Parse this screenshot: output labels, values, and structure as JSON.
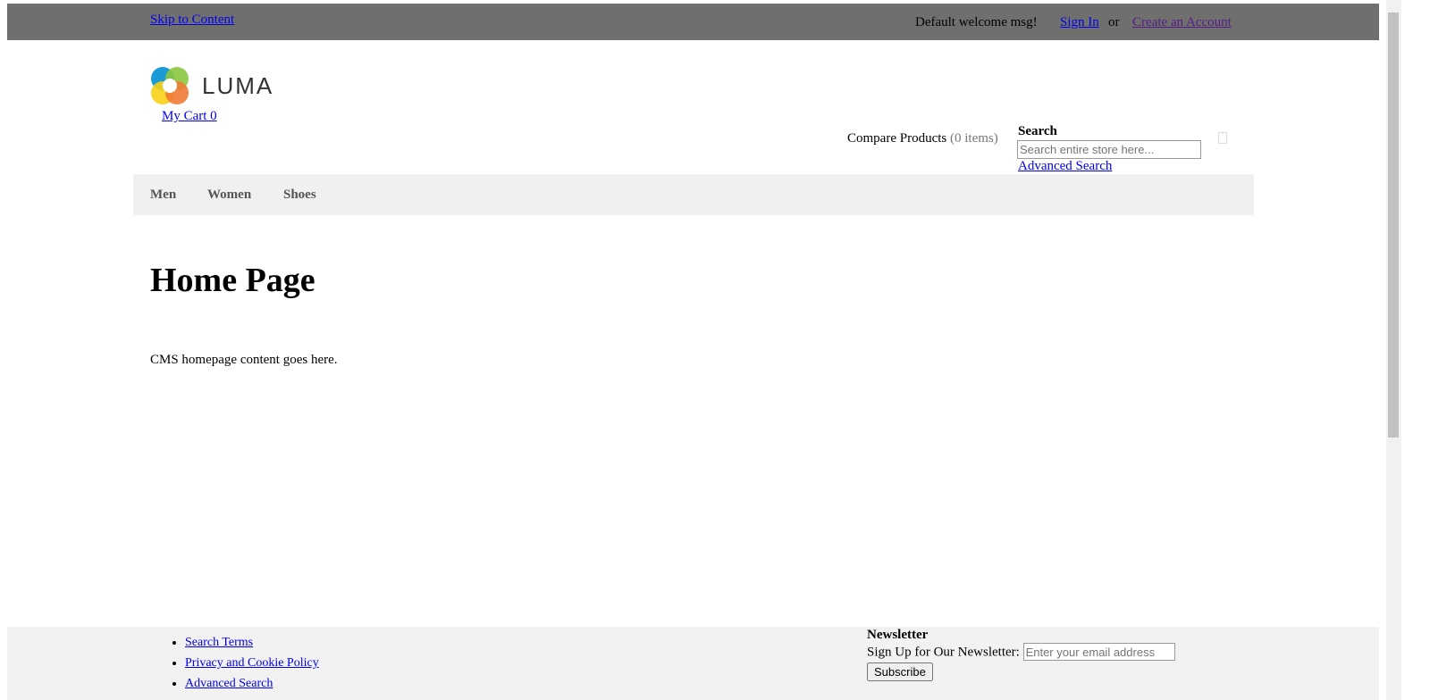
{
  "header": {
    "skip": "Skip to Content",
    "welcome": "Default welcome msg!",
    "sign_in": "Sign In",
    "or": "or",
    "create_account": "Create an Account"
  },
  "logo": {
    "text": "LUMA"
  },
  "cart": {
    "label": "My Cart 0"
  },
  "compare": {
    "label": "Compare Products",
    "count": "(0 items)"
  },
  "search": {
    "label": "Search",
    "placeholder": "Search entire store here...",
    "advanced": "Advanced Search"
  },
  "nav": [
    "Men",
    "Women",
    "Shoes"
  ],
  "main": {
    "title": "Home Page",
    "content": "CMS homepage content goes here."
  },
  "footer": {
    "links": [
      "Search Terms",
      "Privacy and Cookie Policy",
      "Advanced Search"
    ],
    "newsletter_title": "Newsletter",
    "newsletter_label": "Sign Up for Our Newsletter:",
    "newsletter_placeholder": "Enter your email address",
    "subscribe": "Subscribe"
  }
}
